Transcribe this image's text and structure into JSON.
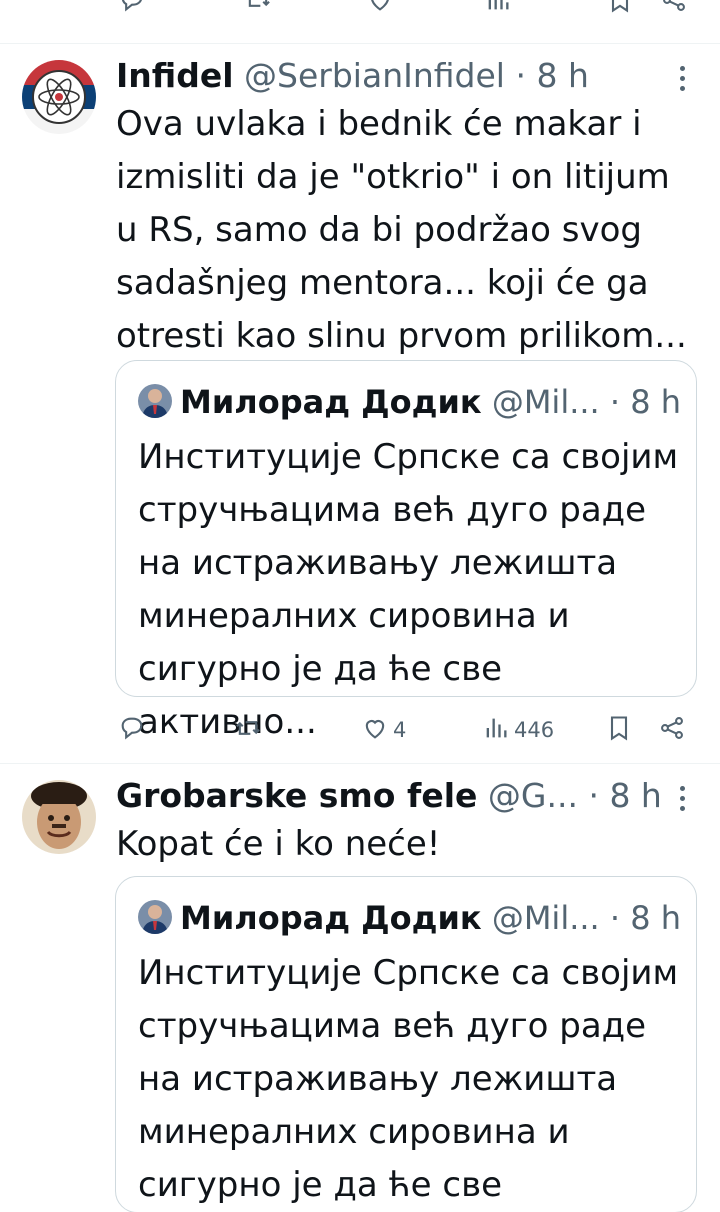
{
  "tweets": [
    {
      "name": "Infidel",
      "handle": "@SerbianInfidel",
      "dot": "·",
      "time": "8 h",
      "text": "Ova uvlaka i bednik će makar i izmisliti da je \"otkrio\" i on litijum u RS, samo da bi podržao svog sadašnjeg mentora... koji će ga otresti kao slinu prvom prilikom...",
      "quote": {
        "name": "Милорад Додик",
        "handle": "@Mil...",
        "dot": "·",
        "time": "8 h",
        "text": "Институције Српске са својим стручњацима већ дуго раде на истраживању лежишта минералних сировина и сигурно је да ће све активно..."
      },
      "actions": {
        "reply_icon": "reply-icon",
        "retweet_icon": "retweet-icon",
        "like_icon": "heart-icon",
        "likes": "4",
        "views_icon": "views-icon",
        "views": "446",
        "bookmark_icon": "bookmark-icon",
        "share_icon": "share-icon"
      }
    },
    {
      "name": "Grobarske smo fele",
      "handle": "@G...",
      "dot": "·",
      "time": "8 h",
      "text": "Kopat će i ko neće!",
      "quote": {
        "name": "Милорад Додик",
        "handle": "@Mil...",
        "dot": "·",
        "time": "8 h",
        "text": "Институције Српске са својим стручњацима већ дуго раде на истраживању лежишта минералних сировина и сигурно је да ће све активно..."
      }
    }
  ],
  "colors": {
    "text": "#0f1419",
    "secondary": "#536471",
    "border": "#cfd9de",
    "divider": "#eff3f4"
  }
}
